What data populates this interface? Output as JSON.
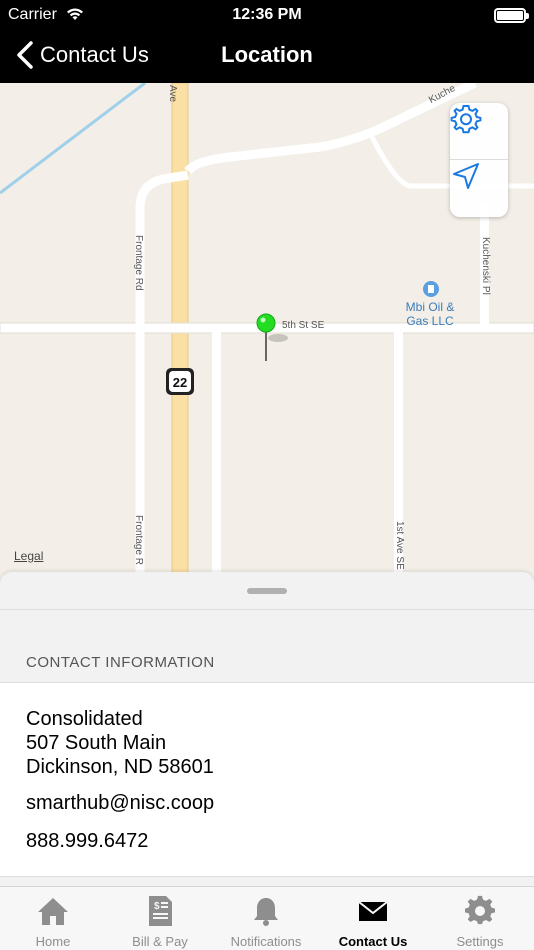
{
  "status_bar": {
    "carrier": "Carrier",
    "time": "12:36 PM"
  },
  "nav": {
    "back_label": "Contact Us",
    "title": "Location"
  },
  "map": {
    "legal": "Legal",
    "poi": "Mbi Oil & Gas LLC",
    "streets": {
      "fifth": "5th St SE",
      "frontage_top": "Frontage Rd",
      "frontage_bottom": "Frontage R",
      "first_ave": "1st Ave SE",
      "kuchenski": "Kuchenski Pl",
      "kuch_top": "Kuche",
      "ave": "Ave"
    },
    "route_shield": "22",
    "pin_color": "#22dd22",
    "icons": {
      "settings": "gear-icon",
      "locate": "location-arrow-icon"
    }
  },
  "contact": {
    "section_header": "CONTACT INFORMATION",
    "name": "Consolidated",
    "street": "507 South Main",
    "city": "Dickinson, ND 58601",
    "email": "smarthub@nisc.coop",
    "phone": "888.999.6472"
  },
  "tabs": [
    {
      "label": "Home",
      "icon": "home-icon"
    },
    {
      "label": "Bill & Pay",
      "icon": "bill-icon"
    },
    {
      "label": "Notifications",
      "icon": "bell-icon"
    },
    {
      "label": "Contact Us",
      "icon": "envelope-icon",
      "active": true
    },
    {
      "label": "Settings",
      "icon": "gear-icon"
    }
  ],
  "colors": {
    "accent": "#1a7ae0",
    "header_bg": "#000000",
    "map_bg": "#f3efe8"
  }
}
